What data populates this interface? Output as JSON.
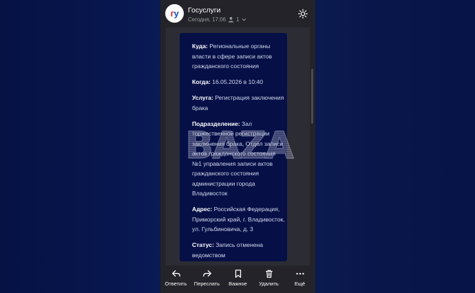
{
  "header": {
    "avatar_text_g": "г",
    "avatar_text_u": "у",
    "sender": "Госуслуги",
    "datetime": "Сегодня, 17:06",
    "recipients_count": "1"
  },
  "message": {
    "fields": [
      {
        "label": "Куда:",
        "value": " Региональные органы власти в сфере записи актов гражданского состояния"
      },
      {
        "label": "Когда:",
        "value": " 16.05.2026 в 10:40"
      },
      {
        "label": "Услуга:",
        "value": " Регистрация заключения брака"
      },
      {
        "label": "Подразделение:",
        "value": " Зал торжественной регистрации заключения брака, Отдел записи актов гражданского состояния №1 управления записи актов гражданского состояния администрации города Владивосток"
      },
      {
        "label": "Адрес:",
        "value": " Российская Федерация, Приморский край, г. Владивосток, ул. Гульбиновича, д. 3"
      },
      {
        "label": "Статус:",
        "value": " Запись отменена ведомством"
      }
    ]
  },
  "watermark": "BAZA",
  "toolbar": {
    "reply": "Ответить",
    "forward": "Переслать",
    "important": "Важное",
    "delete": "Удалить",
    "more": "Ещё"
  },
  "colors": {
    "background": "#06123a",
    "panel": "#232329",
    "message_card": "#061047",
    "brand_red": "#d52b1e",
    "brand_blue": "#0d4cd3"
  },
  "icons": [
    "sun-icon",
    "user-icon",
    "chevron-down-icon",
    "reply-icon",
    "forward-icon",
    "bookmark-icon",
    "trash-icon",
    "more-icon"
  ]
}
